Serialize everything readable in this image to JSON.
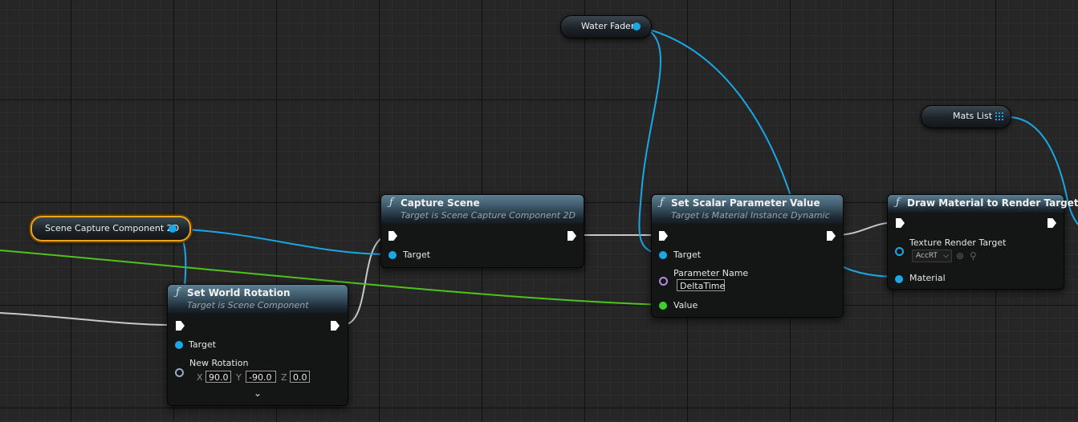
{
  "variables": {
    "scene_capture": {
      "label": "Scene Capture Component 2D"
    },
    "water_fader": {
      "label": "Water Fader"
    },
    "mats_list": {
      "label": "Mats List"
    }
  },
  "nodes": {
    "set_world_rotation": {
      "title": "Set World Rotation",
      "subtitle": "Target is Scene Component",
      "target_label": "Target",
      "new_rotation_label": "New Rotation",
      "x_label": "X",
      "x_value": "90.0",
      "y_label": "Y",
      "y_value": "-90.0",
      "z_label": "Z",
      "z_value": "0.0"
    },
    "capture_scene": {
      "title": "Capture Scene",
      "subtitle": "Target is Scene Capture Component 2D",
      "target_label": "Target"
    },
    "set_scalar": {
      "title": "Set Scalar Parameter Value",
      "subtitle": "Target is Material Instance Dynamic",
      "target_label": "Target",
      "param_name_label": "Parameter Name",
      "param_name_value": "DeltaTime",
      "value_label": "Value"
    },
    "draw_material": {
      "title": "Draw Material to Render Target",
      "texture_label": "Texture Render Target",
      "texture_value": "AccRT",
      "material_label": "Material"
    }
  },
  "icons": {
    "function": "ƒ",
    "chevron_down": "⌄",
    "dropdown_arrow": "⌵",
    "use_asset": "⊕",
    "browse": "⚲"
  },
  "colors": {
    "object_wire": "#1aa7e6",
    "exec_wire": "#c8c8c8",
    "float_wire": "#4fc21c",
    "selected_outline": "#f0a21a",
    "header_blue": "#4d6e80"
  }
}
